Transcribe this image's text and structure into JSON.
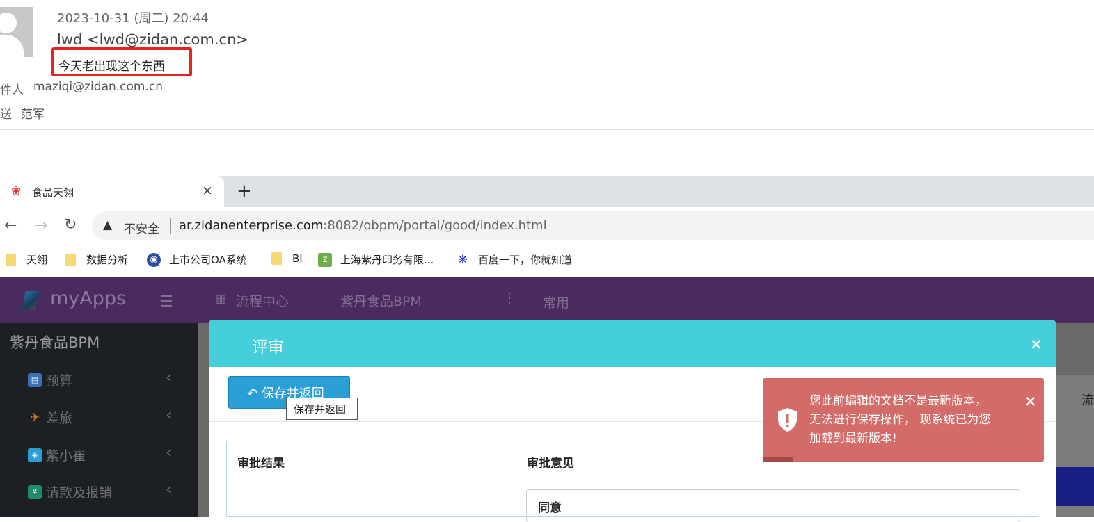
{
  "email": {
    "date": "2023-10-31 (周二) 20:44",
    "from": "lwd <lwd@zidan.com.cn>",
    "subject": "今天老出现这个东西",
    "to_label": "件人",
    "to": "maziqi@zidan.com.cn",
    "cc_label": "送",
    "cc": "范军"
  },
  "browser": {
    "tab_title": "食品天翎",
    "tab_close": "×",
    "new_tab": "+",
    "insecure_label": "不安全",
    "url_host": "ar.zidanenterprise.com",
    "url_rest": ":8082/obpm/portal/good/index.html",
    "bookmarks": [
      "天翎",
      "数据分析",
      "上市公司OA系统",
      "BI",
      "上海紫丹印务有限...",
      "百度一下，你就知道"
    ]
  },
  "app": {
    "logo": "myApps",
    "header_items": [
      "流程中心",
      "紫丹食品BPM",
      "常用"
    ],
    "sidebar_title": "紫丹食品BPM",
    "sidebar_items": [
      "预算",
      "差旅",
      "紫小崔",
      "请款及报销"
    ],
    "right_label": "流"
  },
  "modal": {
    "title": "评审",
    "close": "×",
    "save_button": "保存并返回",
    "tooltip": "保存并返回",
    "col_result": "审批结果",
    "col_opinion": "审批意见",
    "opinion_value": "同意"
  },
  "toast": {
    "line1": "您此前编辑的文档不是最新版本，",
    "line2": "无法进行保存操作， 现系统已为您",
    "line3": "加载到最新版本!",
    "close": "×",
    "color": "#d36b68"
  },
  "colors": {
    "header_purple": "#4b2a60",
    "modal_header": "#45cfdb",
    "button_blue": "#2a9fd6",
    "highlight_red": "#e8231d"
  }
}
